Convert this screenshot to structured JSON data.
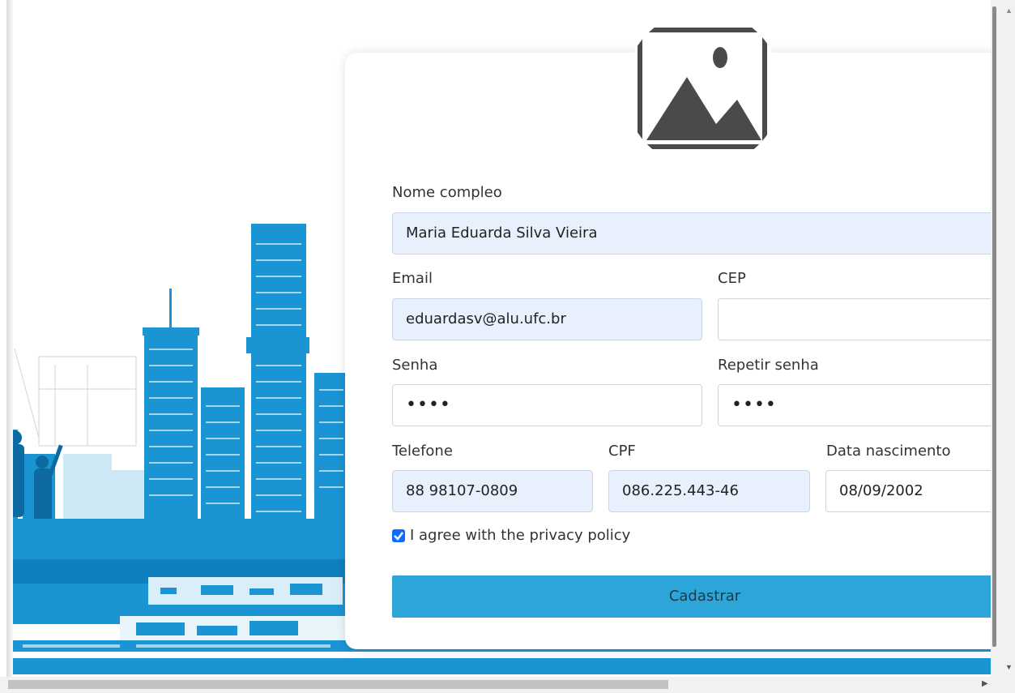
{
  "form": {
    "full_name_label": "Nome compleo",
    "full_name_value": "Maria Eduarda Silva Vieira",
    "email_label": "Email",
    "email_value": "eduardasv@alu.ufc.br",
    "cep_label": "CEP",
    "cep_value": "",
    "password_label": "Senha",
    "password_value": "••••",
    "repeat_password_label": "Repetir senha",
    "repeat_password_value": "••••",
    "phone_label": "Telefone",
    "phone_value": "88 98107-0809",
    "cpf_label": "CPF",
    "cpf_value": "086.225.443-46",
    "birth_label": "Data nascimento",
    "birth_value": "08/09/2002",
    "agree_label": "I agree with the privacy policy",
    "agree_checked": true,
    "submit_label": "Cadastrar"
  },
  "icons": {
    "avatar": "image-placeholder-icon",
    "calendar": "calendar-icon",
    "checkbox": "check-icon"
  },
  "colors": {
    "accent": "#2ea5d9",
    "checkbox": "#0d6efd",
    "autofill_bg": "#e8f0fe",
    "city_blue": "#1a94d2"
  }
}
